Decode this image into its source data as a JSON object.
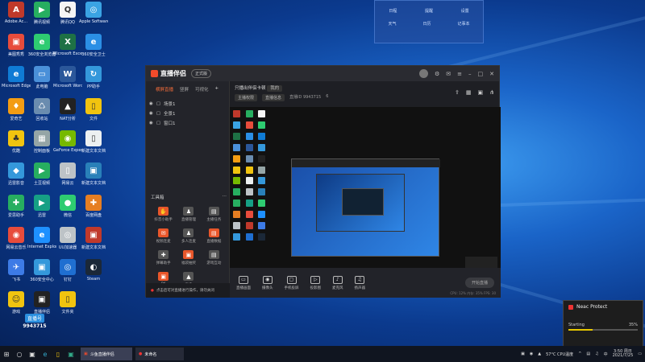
{
  "desktop_icons": [
    {
      "label": "Adobe Ac...",
      "color": "#c0392b",
      "glyph": "A",
      "icon": "adobe-icon"
    },
    {
      "label": "腾讯视频",
      "color": "#27ae60",
      "glyph": "▶",
      "icon": "video-icon"
    },
    {
      "label": "腾讯QQ",
      "color": "#f5f5f5",
      "glyph": "Q",
      "icon": "qq-icon"
    },
    {
      "label": "Apple Software",
      "color": "#3aa3e3",
      "glyph": "◎",
      "icon": "apple-icon"
    },
    {
      "label": "美图秀秀",
      "color": "#e74c3c",
      "glyph": "▣",
      "icon": "app-icon"
    },
    {
      "label": "360安全浏览器",
      "color": "#2ecc71",
      "glyph": "e",
      "icon": "browser-icon"
    },
    {
      "label": "Microsoft Excel",
      "color": "#1e7145",
      "glyph": "X",
      "icon": "excel-icon"
    },
    {
      "label": "360安全卫士",
      "color": "#2b8fe5",
      "glyph": "e",
      "icon": "ie-icon"
    },
    {
      "label": "Microsoft Edge",
      "color": "#0f7bd5",
      "glyph": "e",
      "icon": "edge-icon"
    },
    {
      "label": "此电脑",
      "color": "#4a90d9",
      "glyph": "▭",
      "icon": "computer-icon"
    },
    {
      "label": "Microsoft Word",
      "color": "#2b579a",
      "glyph": "W",
      "icon": "word-icon"
    },
    {
      "label": "PP助手",
      "color": "#3498db",
      "glyph": "↻",
      "icon": "app-icon"
    },
    {
      "label": "爱奇艺",
      "color": "#f39c12",
      "glyph": "♦",
      "icon": "app-icon"
    },
    {
      "label": "回收站",
      "color": "#6a8caf",
      "glyph": "♺",
      "icon": "recycle-bin-icon"
    },
    {
      "label": "NAT分析",
      "color": "#222",
      "glyph": "▲",
      "icon": "app-icon"
    },
    {
      "label": "文件",
      "color": "#f1c40f",
      "glyph": "▯",
      "icon": "folder-icon"
    },
    {
      "label": "优酷",
      "color": "#f1c40f",
      "glyph": "♣",
      "icon": "app-icon"
    },
    {
      "label": "控制面板",
      "color": "#95a5a6",
      "glyph": "▦",
      "icon": "control-panel-icon"
    },
    {
      "label": "GeForce Experience",
      "color": "#76b900",
      "glyph": "◉",
      "icon": "nvidia-icon"
    },
    {
      "label": "新建文本文档",
      "color": "#ecf0f1",
      "glyph": "▯",
      "icon": "text-file-icon"
    },
    {
      "label": "迅雷影音",
      "color": "#3498db",
      "glyph": "◆",
      "icon": "app-icon"
    },
    {
      "label": "土豆视频",
      "color": "#27ae60",
      "glyph": "▶",
      "icon": "video-icon"
    },
    {
      "label": "网易云",
      "color": "#bdc3c7",
      "glyph": "▯",
      "icon": "file-icon"
    },
    {
      "label": "新建文本文档",
      "color": "#2980b9",
      "glyph": "▣",
      "icon": "app-icon"
    },
    {
      "label": "爱思助手",
      "color": "#27ae60",
      "glyph": "✚",
      "icon": "app-icon"
    },
    {
      "label": "迅雷",
      "color": "#16a085",
      "glyph": "▶",
      "icon": "player-icon"
    },
    {
      "label": "微信",
      "color": "#2ecc71",
      "glyph": "●",
      "icon": "wechat-icon"
    },
    {
      "label": "百度网盘",
      "color": "#e67e22",
      "glyph": "✚",
      "icon": "app-icon"
    },
    {
      "label": "网易云音乐",
      "color": "#e74c3c",
      "glyph": "◉",
      "icon": "music-icon"
    },
    {
      "label": "Internet Explorer",
      "color": "#1e90ff",
      "glyph": "e",
      "icon": "ie-icon"
    },
    {
      "label": "UU加速器",
      "color": "#bdc3c7",
      "glyph": "◎",
      "icon": "app-icon"
    },
    {
      "label": "新建文本文档",
      "color": "#c0392b",
      "glyph": "▣",
      "icon": "app-icon"
    },
    {
      "label": "飞书",
      "color": "#3d7be6",
      "glyph": "✈",
      "icon": "feishu-icon"
    },
    {
      "label": "360安全中心",
      "color": "#3498db",
      "glyph": "▣",
      "icon": "app-icon"
    },
    {
      "label": "钉钉",
      "color": "#1f6fd1",
      "glyph": "◎",
      "icon": "app-icon"
    },
    {
      "label": "Steam",
      "color": "#1b2838",
      "glyph": "◐",
      "icon": "steam-icon"
    },
    {
      "label": "游戏",
      "color": "#f1c40f",
      "glyph": "☺",
      "icon": "game-icon"
    },
    {
      "label": "直播伴侣",
      "color": "#222",
      "glyph": "▣",
      "icon": "app-icon"
    },
    {
      "label": "文件夹",
      "color": "#f1c40f",
      "glyph": "▯",
      "icon": "folder-icon"
    }
  ],
  "topwidget": {
    "a": "日程",
    "b": "提醒",
    "c": "设置",
    "d": "天气",
    "e": "日历",
    "f": "记事本"
  },
  "app": {
    "title": "直播伴侣",
    "version": "正式版",
    "tabs": [
      "横屏直播",
      "竖屏",
      "可视化"
    ],
    "scenes": [
      "场景1",
      "全景1",
      "窗口1"
    ],
    "tools_header": "工具箱",
    "tools": [
      {
        "label": "抖音小助手",
        "color": "#e8562a",
        "glyph": "✋",
        "icon": "hand-icon"
      },
      {
        "label": "直播管理",
        "color": "#555",
        "glyph": "♟",
        "icon": "user-icon"
      },
      {
        "label": "主播任务",
        "color": "#555",
        "glyph": "▤",
        "icon": "task-icon"
      },
      {
        "label": "视频连麦",
        "color": "#e8562a",
        "glyph": "✉",
        "icon": "video-icon"
      },
      {
        "label": "多人连麦",
        "color": "#555",
        "glyph": "♟",
        "icon": "users-icon"
      },
      {
        "label": "直播数据",
        "color": "#e8562a",
        "glyph": "▤",
        "icon": "data-icon"
      },
      {
        "label": "弹幕助手",
        "color": "#555",
        "glyph": "✚",
        "icon": "danmaku-icon"
      },
      {
        "label": "福袋抽奖",
        "color": "#e8562a",
        "glyph": "▣",
        "icon": "gift-icon"
      },
      {
        "label": "游戏互动",
        "color": "#555",
        "glyph": "▤",
        "icon": "game-icon"
      },
      {
        "label": "PK",
        "color": "#e8562a",
        "glyph": "▣",
        "icon": "pk-icon"
      },
      {
        "label": "更多",
        "color": "#555",
        "glyph": "▲",
        "icon": "more-icon"
      }
    ],
    "tip": "点击后可对直播进行操作，请勿关闭",
    "main_title": "只播出伴侣卡顿",
    "main_badge": "我的",
    "main_sub": [
      "主播权限",
      "直播信息",
      "直播ID 9943715",
      "6"
    ],
    "bottom_buttons": [
      {
        "label": "直播画面",
        "glyph": "▭",
        "icon": "screen-icon"
      },
      {
        "label": "摄像头",
        "glyph": "◉",
        "icon": "camera-icon"
      },
      {
        "label": "手机投屏",
        "glyph": "▢",
        "icon": "phone-icon"
      },
      {
        "label": "投影图",
        "glyph": "▷",
        "icon": "media-icon"
      },
      {
        "label": "麦克风",
        "glyph": "♪",
        "icon": "mic-icon"
      },
      {
        "label": "扬声器",
        "glyph": "♫",
        "icon": "speaker-icon"
      }
    ],
    "start_live": "开始直播",
    "status_line": "CPU: 12%  内存: 35%  FPS: 30"
  },
  "notice": {
    "title": "Neac Protect",
    "status": "Starting",
    "percent": "35%",
    "progress": 0.35
  },
  "watermark": {
    "top": "直播号",
    "id": "9943715"
  },
  "taskbar": {
    "apps": [
      {
        "label": "斗鱼直播伴侣",
        "icon": "live-app-icon"
      },
      {
        "label": "未命名",
        "icon": "record-icon"
      }
    ],
    "weather": "57°C CPU温度",
    "lang": "中",
    "time": "3:50 周日",
    "date": "2021/7/25"
  }
}
